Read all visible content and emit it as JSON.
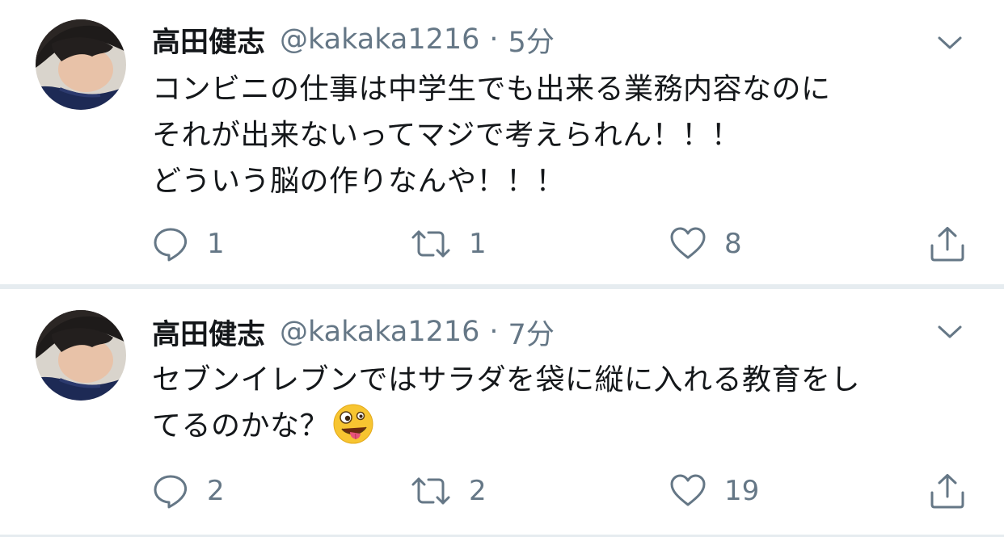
{
  "tweets": [
    {
      "author_name": "高田健志",
      "handle": "@kakaka1216",
      "separator": "·",
      "time": "5分",
      "text_lines": [
        "コンビニの仕事は中学生でも出来る業務内容なのに",
        "それが出来ないってマジで考えられん！！！",
        "どういう脳の作りなんや！！！"
      ],
      "replies": "1",
      "retweets": "1",
      "likes": "8"
    },
    {
      "author_name": "高田健志",
      "handle": "@kakaka1216",
      "separator": "·",
      "time": "7分",
      "text_lines": [
        "セブンイレブンではサラダを袋に縦に入れる教育をし",
        "てるのかな？"
      ],
      "emoji": "zany-face-emoji",
      "replies": "2",
      "retweets": "2",
      "likes": "19"
    }
  ],
  "icons": {
    "reply": "reply-icon",
    "retweet": "retweet-icon",
    "like": "heart-icon",
    "share": "share-icon",
    "menu": "chevron-down-icon"
  },
  "colors": {
    "text_primary": "#14171a",
    "text_secondary": "#657786",
    "divider": "#e6ecf0",
    "background": "#ffffff"
  }
}
